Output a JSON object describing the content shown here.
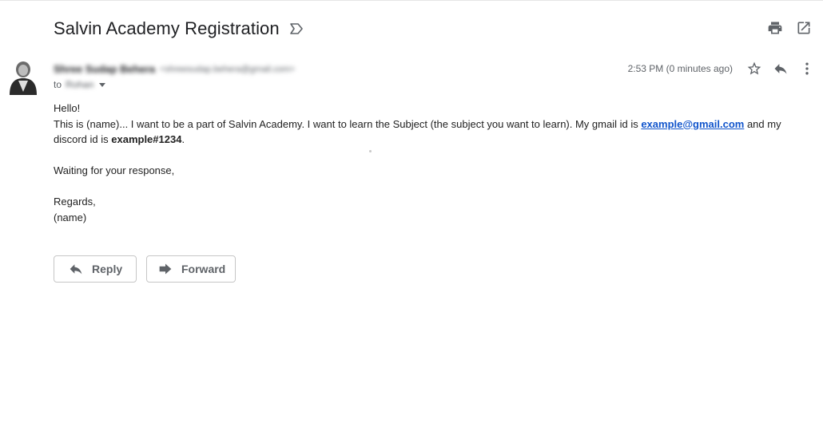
{
  "email": {
    "subject": "Salvin Academy Registration",
    "sender_name": "Shree Sudap Behera",
    "sender_email": "<shreesudap.behera@gmail.com>",
    "to_label": "to",
    "to_name": "Rohan",
    "time": "2:53 PM (0 minutes ago)"
  },
  "body": {
    "greeting": "Hello!",
    "line1_part1": "This is (name)... I want to be a part of Salvin Academy. I want to learn the Subject (the subject you want to learn). My gmail id is ",
    "gmail_link": "example@gmail.com",
    "line1_part2": " and my discord id is ",
    "discord_id": "example#1234",
    "line1_end": ".",
    "waiting": "Waiting for your response,",
    "regards": "Regards,",
    "signature": "(name)"
  },
  "actions": {
    "reply_label": "Reply",
    "forward_label": "Forward"
  },
  "icons": {
    "important": "important-marker-icon",
    "print": "print-icon",
    "new_window": "open-in-new-window-icon",
    "star": "star-icon",
    "reply": "reply-icon",
    "more": "more-vertical-icon",
    "forward": "forward-icon"
  },
  "colors": {
    "link": "#1155cc",
    "icon": "#5f6368",
    "subject": "#202124"
  }
}
